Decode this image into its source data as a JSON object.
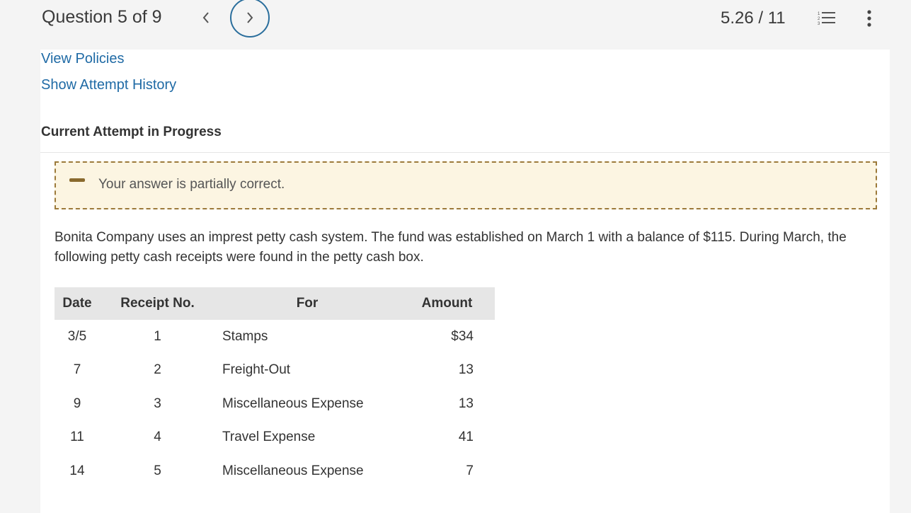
{
  "header": {
    "question_label": "Question 5 of 9",
    "prev_symbol": "<",
    "next_symbol": ">",
    "score": "5.26 / 11"
  },
  "links": {
    "view_policies": "View Policies",
    "show_attempt_history": "Show Attempt History"
  },
  "attempt_heading": "Current Attempt in Progress",
  "feedback": {
    "text": "Your answer is partially correct."
  },
  "problem_text": "Bonita Company uses an imprest petty cash system. The fund was established on March 1 with a balance of $115. During March, the following petty cash receipts were found in the petty cash box.",
  "table": {
    "headers": [
      "Date",
      "Receipt No.",
      "For",
      "Amount"
    ],
    "rows": [
      {
        "date": "3/5",
        "receipt": "1",
        "for": "Stamps",
        "amount": "$34"
      },
      {
        "date": "7",
        "receipt": "2",
        "for": "Freight-Out",
        "amount": "13"
      },
      {
        "date": "9",
        "receipt": "3",
        "for": "Miscellaneous Expense",
        "amount": "13"
      },
      {
        "date": "11",
        "receipt": "4",
        "for": "Travel Expense",
        "amount": "41"
      },
      {
        "date": "14",
        "receipt": "5",
        "for": "Miscellaneous Expense",
        "amount": "7"
      }
    ]
  },
  "colors": {
    "link": "#1f6aa5",
    "nav_circle": "#2a6e9c",
    "feedback_bg": "#fcf5e2",
    "feedback_border": "#9c7a3a"
  }
}
